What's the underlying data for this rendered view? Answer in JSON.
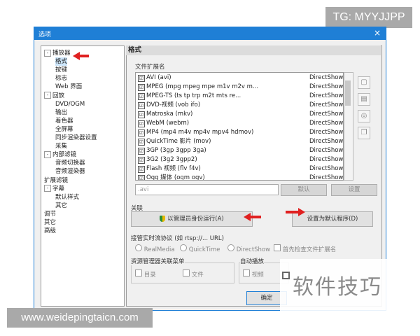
{
  "watermarks": {
    "top": "TG: MYYJJPP",
    "bottom": "www.weidepingtaicn.com",
    "overlay": "软件技巧"
  },
  "window": {
    "title": "选项",
    "close": "×"
  },
  "tree": [
    {
      "label": "播放器",
      "level": 0,
      "toggle": "-"
    },
    {
      "label": "格式",
      "level": 1,
      "selected": true
    },
    {
      "label": "按键",
      "level": 1
    },
    {
      "label": "标志",
      "level": 1
    },
    {
      "label": "Web 界面",
      "level": 1
    },
    {
      "label": "回放",
      "level": 0,
      "toggle": "-"
    },
    {
      "label": "DVD/OGM",
      "level": 1
    },
    {
      "label": "输出",
      "level": 1
    },
    {
      "label": "着色器",
      "level": 1
    },
    {
      "label": "全屏幕",
      "level": 1
    },
    {
      "label": "同步渲染器设置",
      "level": 1
    },
    {
      "label": "采集",
      "level": 1
    },
    {
      "label": "内部滤镜",
      "level": 0,
      "toggle": "-"
    },
    {
      "label": "音频切换器",
      "level": 1
    },
    {
      "label": "音频渲染器",
      "level": 1
    },
    {
      "label": "扩展滤镜",
      "level": 0
    },
    {
      "label": "字幕",
      "level": 0,
      "toggle": "-"
    },
    {
      "label": "默认样式",
      "level": 1
    },
    {
      "label": "其它",
      "level": 1
    },
    {
      "label": "调节",
      "level": 0
    },
    {
      "label": "其它",
      "level": 0
    },
    {
      "label": "高级",
      "level": 0
    }
  ],
  "panel": {
    "header": "格式",
    "ext_label": "文件扩展名",
    "formats": [
      {
        "name": "AVI (avi)",
        "handler": "DirectShow"
      },
      {
        "name": "MPEG (mpg mpeg mpe m1v m2v m...",
        "handler": "DirectShow"
      },
      {
        "name": "MPEG-TS (ts tp trp m2t mts re...",
        "handler": "DirectShow"
      },
      {
        "name": "DVD-视频 (vob ifo)",
        "handler": "DirectShow"
      },
      {
        "name": "Matroska (mkv)",
        "handler": "DirectShow"
      },
      {
        "name": "WebM (webm)",
        "handler": "DirectShow"
      },
      {
        "name": "MP4 (mp4 m4v mp4v mpv4 hdmov)",
        "handler": "DirectShow"
      },
      {
        "name": "QuickTime 影片 (mov)",
        "handler": "DirectShow"
      },
      {
        "name": "3GP (3gp 3gpp 3ga)",
        "handler": "DirectShow"
      },
      {
        "name": "3G2 (3g2 3gpp2)",
        "handler": "DirectShow"
      },
      {
        "name": "Flash 视频 (flv f4v)",
        "handler": "DirectShow"
      },
      {
        "name": "Ogg 媒体 (ogm ogv)",
        "handler": "DirectShow"
      }
    ],
    "check_mark": "☑",
    "side_icons": [
      "▢",
      "▤",
      "◎",
      "❐"
    ],
    "ext_value": ".avi",
    "default_button": "默认",
    "settings_button": "设置",
    "assoc_label": "关联",
    "run_as_admin_button": "以管理员身份运行(A)",
    "set_default_button": "设置为默认程序(D)",
    "realtime_label": "接管实时流协议 (如 rtsp://... URL)",
    "radio_realmedia": "RealMedia",
    "radio_quicktime": "QuickTime",
    "radio_directshow": "DirectShow",
    "check_file_ext": "首先检查文件扩展名",
    "explorer_label": "资源管理器关联菜单",
    "check_directory": "目录",
    "check_files": "文件",
    "autoplay_label": "自动播放",
    "check_video": "视频",
    "ok_button": "确定"
  },
  "colors": {
    "titlebar": "#1f7fd6",
    "arrow": "#e02020",
    "selection": "#cde6fb"
  }
}
